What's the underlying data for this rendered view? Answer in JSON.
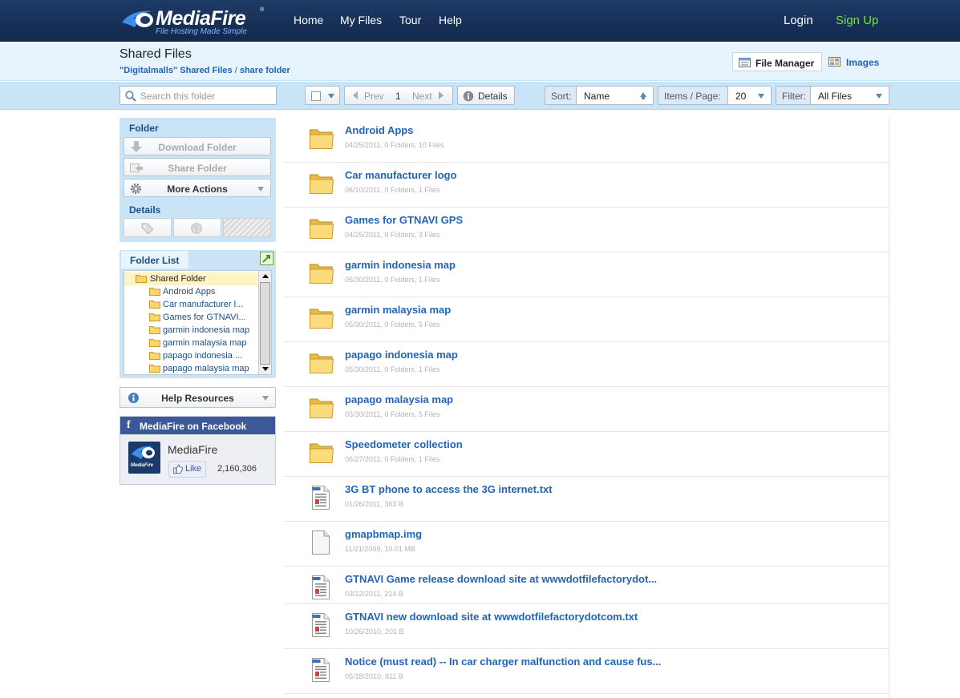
{
  "header": {
    "logo_text": "MediaFire",
    "logo_reg": "®",
    "tagline": "File Hosting Made Simple",
    "nav": [
      "Home",
      "My Files",
      "Tour",
      "Help"
    ],
    "login": "Login",
    "signup": "Sign Up"
  },
  "subheader": {
    "title": "Shared Files",
    "breadcrumb_owner": "\"Digitalmalls\" Shared Files",
    "breadcrumb_sep": "/",
    "breadcrumb_folder": "share folder",
    "file_manager": "File Manager",
    "images": "Images"
  },
  "toolbar": {
    "search_placeholder": "Search this folder",
    "prev": "Prev",
    "page": "1",
    "next": "Next",
    "details": "Details",
    "sort_label": "Sort:",
    "sort_value": "Name",
    "per_page_label": "Items / Page:",
    "per_page_value": "20",
    "filter_label": "Filter:",
    "filter_value": "All Files"
  },
  "sidebar": {
    "folder_heading": "Folder",
    "download_folder": "Download Folder",
    "share_folder": "Share Folder",
    "more_actions": "More Actions",
    "details_heading": "Details",
    "folder_list_tab": "Folder List",
    "tree_root": "Shared Folder",
    "tree_items": [
      "Android Apps",
      "Car manufacturer l...",
      "Games for GTNAVI...",
      "garmin indonesia map",
      "garmin malaysia map",
      "papago indonesia ...",
      "papago malaysia map"
    ],
    "help_resources": "Help Resources",
    "facebook_header": "MediaFire on Facebook",
    "facebook_name": "MediaFire",
    "facebook_logo_text": "MediaFire",
    "like": "Like",
    "like_count": "2,160,306"
  },
  "files": [
    {
      "name": "Android Apps",
      "meta": "04/25/2011, 0 Folders, 10 Files",
      "icon": "folder-icon"
    },
    {
      "name": "Car manufacturer logo",
      "meta": "06/10/2011, 0 Folders, 1 Files",
      "icon": "folder-icon"
    },
    {
      "name": "Games for GTNAVI GPS",
      "meta": "04/25/2011, 0 Folders, 3 Files",
      "icon": "folder-icon"
    },
    {
      "name": "garmin indonesia map",
      "meta": "05/30/2011, 0 Folders, 1 Files",
      "icon": "folder-icon"
    },
    {
      "name": "garmin malaysia map",
      "meta": "05/30/2011, 0 Folders, 5 Files",
      "icon": "folder-icon"
    },
    {
      "name": "papago indonesia map",
      "meta": "05/30/2011, 0 Folders, 1 Files",
      "icon": "folder-icon"
    },
    {
      "name": "papago malaysia map",
      "meta": "05/30/2011, 0 Folders, 5 Files",
      "icon": "folder-icon"
    },
    {
      "name": "Speedometer collection",
      "meta": "06/27/2011, 0 Folders, 1 Files",
      "icon": "folder-icon"
    },
    {
      "name": "3G BT phone to access the 3G internet.txt",
      "meta": "01/26/2011, 363 B",
      "icon": "text-file-icon"
    },
    {
      "name": "gmapbmap.img",
      "meta": "11/21/2009, 10.01 MB",
      "icon": "blank-file-icon"
    },
    {
      "name": "GTNAVI Game release download site at wwwdotfilefactorydot...",
      "meta": "03/12/2011, 214 B",
      "icon": "text-file-icon"
    },
    {
      "name": "GTNAVI new download site at wwwdotfilefactorydotcom.txt",
      "meta": "10/26/2010, 201 B",
      "icon": "text-file-icon"
    },
    {
      "name": "Notice (must read) -- In car charger malfunction and cause fus...",
      "meta": "05/18/2010, 811 B",
      "icon": "text-file-icon"
    }
  ],
  "colors": {
    "header_bg": "#1d3a66",
    "link": "#2264b8",
    "signup": "#7cdf3b",
    "panel_bg": "#c9e3f7",
    "facebook": "#3b5998"
  }
}
